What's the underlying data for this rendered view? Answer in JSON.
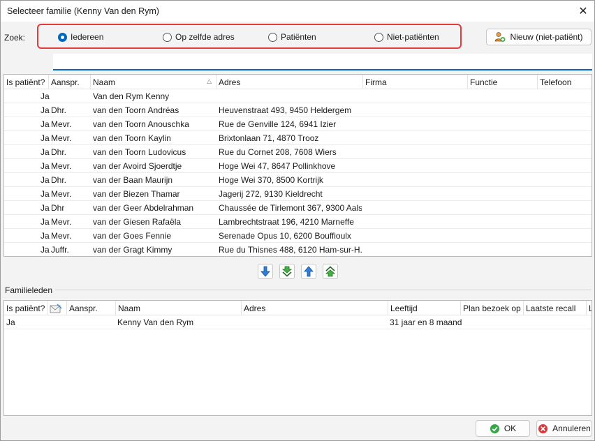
{
  "window": {
    "title": "Selecteer familie (Kenny Van den Rym)"
  },
  "search": {
    "label": "Zoek:",
    "options": [
      {
        "label": "Iedereen",
        "selected": true
      },
      {
        "label": "Op zelfde adres",
        "selected": false
      },
      {
        "label": "Patiënten",
        "selected": false
      },
      {
        "label": "Niet-patiënten",
        "selected": false
      }
    ],
    "value": ""
  },
  "toolbar": {
    "new_label": "Nieuw (niet-patiënt)"
  },
  "results": {
    "columns": [
      "Is patiënt?",
      "Aanspr.",
      "Naam",
      "Adres",
      "Firma",
      "Functie",
      "Telefoon"
    ],
    "rows": [
      {
        "patient": "Ja",
        "aanspr": "",
        "naam": "Van den Rym Kenny",
        "adres": ""
      },
      {
        "patient": "Ja",
        "aanspr": "Dhr.",
        "naam": "van den Toorn Andréas",
        "adres": "Heuvenstraat 493, 9450 Heldergem"
      },
      {
        "patient": "Ja",
        "aanspr": "Mevr.",
        "naam": "van den Toorn Anouschka",
        "adres": "Rue de Genville 124, 6941 Izier"
      },
      {
        "patient": "Ja",
        "aanspr": "Mevr.",
        "naam": "van den Toorn Kaylin",
        "adres": "Brixtonlaan 71, 4870 Trooz"
      },
      {
        "patient": "Ja",
        "aanspr": "Dhr.",
        "naam": "van den Toorn Ludovicus",
        "adres": "Rue du Cornet 208, 7608 Wiers"
      },
      {
        "patient": "Ja",
        "aanspr": "Mevr.",
        "naam": "van der Avoird Sjoerdtje",
        "adres": "Hoge Wei 47, 8647 Pollinkhove"
      },
      {
        "patient": "Ja",
        "aanspr": "Dhr.",
        "naam": "van der Baan Maurijn",
        "adres": "Hoge Wei 370, 8500 Kortrijk"
      },
      {
        "patient": "Ja",
        "aanspr": "Mevr.",
        "naam": "van der Biezen Thamar",
        "adres": "Jagerij 272, 9130 Kieldrecht"
      },
      {
        "patient": "Ja",
        "aanspr": "Dhr",
        "naam": "van der Geer Abdelrahman",
        "adres": "Chaussée de Tirlemont 367, 9300 Aalst"
      },
      {
        "patient": "Ja",
        "aanspr": "Mevr.",
        "naam": "van der Giesen Rafaëla",
        "adres": "Lambrechtstraat 196, 4210 Marneffe"
      },
      {
        "patient": "Ja",
        "aanspr": "Mevr.",
        "naam": "van der Goes Fennie",
        "adres": "Serenade Opus 10, 6200 Bouffioulx"
      },
      {
        "patient": "Ja",
        "aanspr": "Juffr.",
        "naam": "van der Gragt Kimmy",
        "adres": "Rue du Thisnes 488, 6120 Ham-sur-H..."
      }
    ]
  },
  "family": {
    "group_label": "Familieleden",
    "columns": [
      "Is patiënt?",
      "",
      "Aanspr.",
      "Naam",
      "Adres",
      "Leeftijd",
      "Plan bezoek op",
      "Laatste recall",
      "L"
    ],
    "rows": [
      {
        "patient": "Ja",
        "aanspr": "",
        "naam": "Kenny Van den Rym",
        "adres": "",
        "leeftijd": "31 jaar en 8 maand"
      }
    ]
  },
  "footer": {
    "ok_label": "OK",
    "cancel_label": "Annuleren"
  },
  "colors": {
    "accent": "#0067c0",
    "highlight_border": "#e23b3b"
  }
}
